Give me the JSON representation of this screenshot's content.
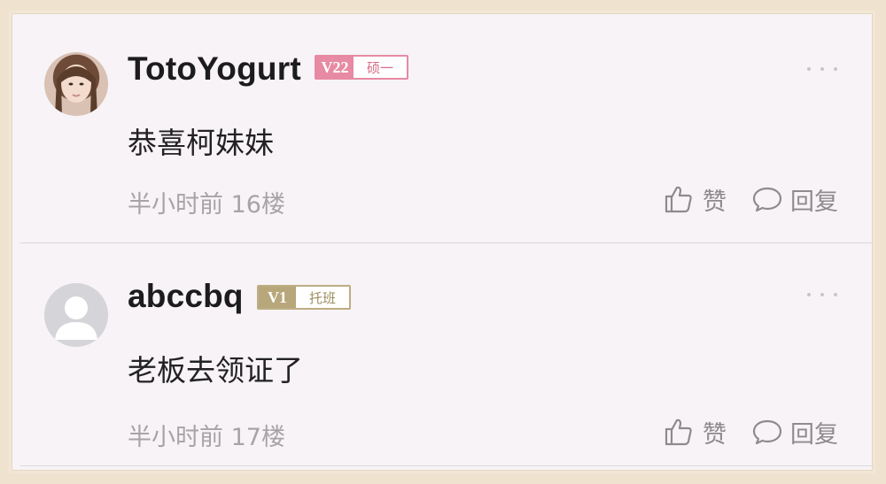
{
  "comments": [
    {
      "username": "TotoYogurt",
      "badge": {
        "level": "V22",
        "title": "硕一",
        "color": "#e78aa3"
      },
      "content": "恭喜柯妹妹",
      "time": "半小时前",
      "floor": "16楼",
      "like_label": "赞",
      "reply_label": "回复",
      "avatar": "user-photo"
    },
    {
      "username": "abccbq",
      "badge": {
        "level": "V1",
        "title": "托班",
        "color": "#b7a77b"
      },
      "content": "老板去领证了",
      "time": "半小时前",
      "floor": "17楼",
      "like_label": "赞",
      "reply_label": "回复",
      "avatar": "default-user-icon"
    }
  ],
  "icons": {
    "more": "more-dots-icon",
    "like": "thumbs-up-icon",
    "reply": "speech-bubble-icon"
  }
}
